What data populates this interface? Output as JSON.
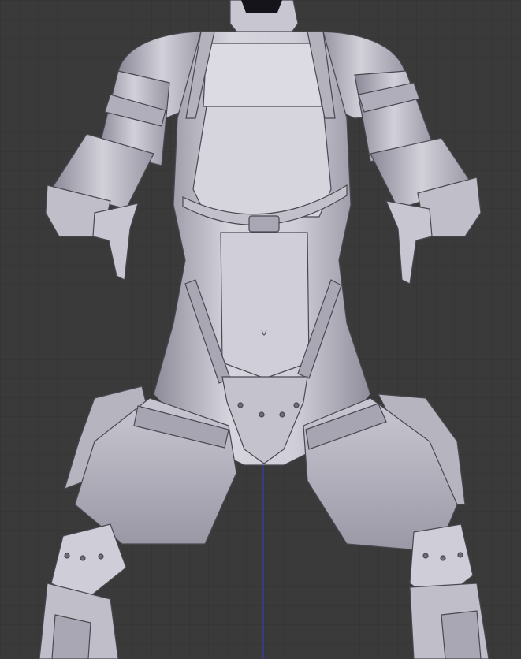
{
  "viewport": {
    "background_color": "#3a3a3a",
    "grid_minor_color": "#313131",
    "grid_major_color": "#2b2b2b",
    "z_axis_color": "#3a3ac8",
    "model_base_color": "#b9b7c2",
    "model_light_color": "#dcdbe3",
    "model_shadow_color": "#8d8b98",
    "model_edge_color": "#4a4850",
    "object": "armored-bodysuit-figure"
  }
}
